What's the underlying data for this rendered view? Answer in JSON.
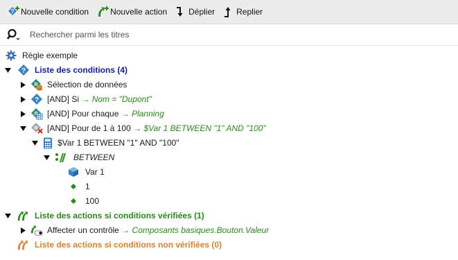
{
  "toolbar": {
    "new_condition": "Nouvelle condition",
    "new_action": "Nouvelle action",
    "expand": "Déplier",
    "collapse": "Replier"
  },
  "search": {
    "placeholder": "Rechercher parmi les titres",
    "value": ""
  },
  "tree": {
    "root": "Règle exemple",
    "conditions_header": "Liste des conditions (4)",
    "cond_data_selection": "Sélection de données",
    "cond_if_prefix": "[AND] Si",
    "cond_if_expr": "Nom = \"Dupont\"",
    "cond_foreach_prefix": "[AND] Pour chaque",
    "cond_foreach_expr": "Planning",
    "cond_for_prefix": "[AND] Pour de 1 à 100",
    "cond_for_expr": "$Var 1 BETWEEN \"1\" AND \"100\"",
    "calc_expr": "$Var 1 BETWEEN \"1\" AND \"100\"",
    "between_op": "BETWEEN",
    "operand_var": "Var 1",
    "operand_1": "1",
    "operand_2": "100",
    "actions_true_header": "Liste des actions si conditions vérifiées (1)",
    "action_assign_prefix": "Affecter un contrôle",
    "action_assign_expr": "Composants basiques.Bouton.Valeur",
    "actions_false_header": "Liste des actions si conditions non vérifiées (0)",
    "arrow": "→"
  },
  "colors": {
    "condition_blue": "#1520a6",
    "action_green": "#2a8a1c",
    "action_orange": "#d9822b",
    "icon_teal": "#2f8f7f",
    "icon_blue": "#3a82c7"
  },
  "icons": {
    "new_condition": "condition-plus-icon",
    "new_action": "action-plus-icon",
    "expand": "arrow-down-icon",
    "collapse": "arrow-up-icon",
    "search": "search-icon",
    "root": "gear-icon"
  }
}
